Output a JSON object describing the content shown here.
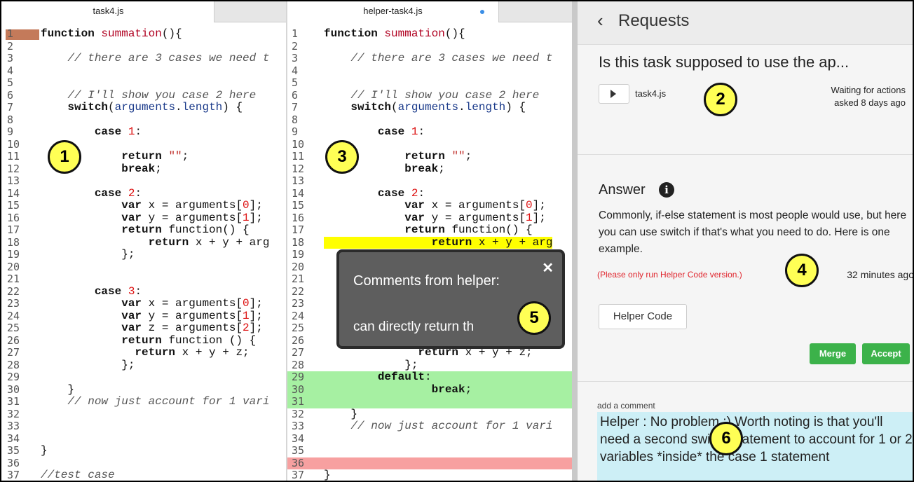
{
  "left_editor": {
    "tab_label": "task4.js",
    "lines": [
      {
        "n": "1",
        "segs": [
          [
            "kw",
            "function "
          ],
          [
            "fn",
            "summation"
          ],
          [
            "",
            "(){"
          ]
        ]
      },
      {
        "n": "2",
        "segs": []
      },
      {
        "n": "3",
        "segs": [
          [
            "",
            "    "
          ],
          [
            "cm",
            "// there are 3 cases we need t"
          ]
        ]
      },
      {
        "n": "4",
        "segs": []
      },
      {
        "n": "5",
        "segs": []
      },
      {
        "n": "6",
        "segs": [
          [
            "",
            "    "
          ],
          [
            "cm",
            "// I'll show you case 2 here"
          ]
        ]
      },
      {
        "n": "7",
        "segs": [
          [
            "",
            "    "
          ],
          [
            "kw",
            "switch"
          ],
          [
            "",
            "("
          ],
          [
            "prop",
            "arguments"
          ],
          [
            "",
            "."
          ],
          [
            "prop",
            "length"
          ],
          [
            "",
            ") {"
          ]
        ]
      },
      {
        "n": "8",
        "segs": []
      },
      {
        "n": "9",
        "segs": [
          [
            "",
            "        "
          ],
          [
            "kw",
            "case "
          ],
          [
            "num",
            "1"
          ],
          [
            "",
            ":"
          ]
        ]
      },
      {
        "n": "10",
        "segs": []
      },
      {
        "n": "11",
        "segs": [
          [
            "",
            "            "
          ],
          [
            "kw",
            "return "
          ],
          [
            "str",
            "\"\""
          ],
          [
            "",
            ";"
          ]
        ]
      },
      {
        "n": "12",
        "segs": [
          [
            "",
            "            "
          ],
          [
            "kw",
            "break"
          ],
          [
            "",
            ";"
          ]
        ]
      },
      {
        "n": "13",
        "segs": []
      },
      {
        "n": "14",
        "segs": [
          [
            "",
            "        "
          ],
          [
            "kw",
            "case "
          ],
          [
            "num",
            "2"
          ],
          [
            "",
            ":"
          ]
        ]
      },
      {
        "n": "15",
        "segs": [
          [
            "",
            "            "
          ],
          [
            "kw",
            "var "
          ],
          [
            "",
            "x = arguments["
          ],
          [
            "num",
            "0"
          ],
          [
            "",
            "];"
          ]
        ]
      },
      {
        "n": "16",
        "segs": [
          [
            "",
            "            "
          ],
          [
            "kw",
            "var "
          ],
          [
            "",
            "y = arguments["
          ],
          [
            "num",
            "1"
          ],
          [
            "",
            "];"
          ]
        ]
      },
      {
        "n": "17",
        "segs": [
          [
            "",
            "            "
          ],
          [
            "kw",
            "return "
          ],
          [
            "",
            "function() {"
          ]
        ]
      },
      {
        "n": "18",
        "segs": [
          [
            "",
            "                "
          ],
          [
            "kw",
            "return "
          ],
          [
            "",
            "x + y + arg"
          ]
        ]
      },
      {
        "n": "19",
        "segs": [
          [
            "",
            "            };"
          ]
        ]
      },
      {
        "n": "20",
        "segs": []
      },
      {
        "n": "21",
        "segs": []
      },
      {
        "n": "22",
        "segs": [
          [
            "",
            "        "
          ],
          [
            "kw",
            "case "
          ],
          [
            "num",
            "3"
          ],
          [
            "",
            ":"
          ]
        ]
      },
      {
        "n": "23",
        "segs": [
          [
            "",
            "            "
          ],
          [
            "kw",
            "var "
          ],
          [
            "",
            "x = arguments["
          ],
          [
            "num",
            "0"
          ],
          [
            "",
            "];"
          ]
        ]
      },
      {
        "n": "24",
        "segs": [
          [
            "",
            "            "
          ],
          [
            "kw",
            "var "
          ],
          [
            "",
            "y = arguments["
          ],
          [
            "num",
            "1"
          ],
          [
            "",
            "];"
          ]
        ]
      },
      {
        "n": "25",
        "segs": [
          [
            "",
            "            "
          ],
          [
            "kw",
            "var "
          ],
          [
            "",
            "z = arguments["
          ],
          [
            "num",
            "2"
          ],
          [
            "",
            "];"
          ]
        ]
      },
      {
        "n": "26",
        "segs": [
          [
            "",
            "            "
          ],
          [
            "kw",
            "return "
          ],
          [
            "",
            "function () {"
          ]
        ]
      },
      {
        "n": "27",
        "segs": [
          [
            "",
            "              "
          ],
          [
            "kw",
            "return "
          ],
          [
            "",
            "x + y + z;"
          ]
        ]
      },
      {
        "n": "28",
        "segs": [
          [
            "",
            "            };"
          ]
        ]
      },
      {
        "n": "29",
        "segs": []
      },
      {
        "n": "30",
        "segs": [
          [
            "",
            "    }"
          ]
        ]
      },
      {
        "n": "31",
        "segs": [
          [
            "",
            "    "
          ],
          [
            "cm",
            "// now just account for 1 vari"
          ]
        ]
      },
      {
        "n": "32",
        "segs": []
      },
      {
        "n": "33",
        "segs": []
      },
      {
        "n": "34",
        "segs": []
      },
      {
        "n": "35",
        "segs": [
          [
            "",
            "}"
          ]
        ]
      },
      {
        "n": "36",
        "segs": []
      },
      {
        "n": "37",
        "segs": [
          [
            "cm",
            "//test case"
          ]
        ]
      }
    ]
  },
  "right_editor": {
    "tab_label": "helper-task4.js",
    "lines": [
      {
        "n": "1",
        "segs": [
          [
            "kw",
            "function "
          ],
          [
            "fn",
            "summation"
          ],
          [
            "",
            "(){"
          ]
        ]
      },
      {
        "n": "2",
        "segs": []
      },
      {
        "n": "3",
        "segs": [
          [
            "",
            "    "
          ],
          [
            "cm",
            "// there are 3 cases we need t"
          ]
        ]
      },
      {
        "n": "4",
        "segs": []
      },
      {
        "n": "5",
        "segs": []
      },
      {
        "n": "6",
        "segs": [
          [
            "",
            "    "
          ],
          [
            "cm",
            "// I'll show you case 2 here"
          ]
        ]
      },
      {
        "n": "7",
        "segs": [
          [
            "",
            "    "
          ],
          [
            "kw",
            "switch"
          ],
          [
            "",
            "("
          ],
          [
            "prop",
            "arguments"
          ],
          [
            "",
            "."
          ],
          [
            "prop",
            "length"
          ],
          [
            "",
            ") {"
          ]
        ]
      },
      {
        "n": "8",
        "segs": []
      },
      {
        "n": "9",
        "segs": [
          [
            "",
            "        "
          ],
          [
            "kw",
            "case "
          ],
          [
            "num",
            "1"
          ],
          [
            "",
            ":"
          ]
        ]
      },
      {
        "n": "10",
        "segs": []
      },
      {
        "n": "11",
        "segs": [
          [
            "",
            "            "
          ],
          [
            "kw",
            "return "
          ],
          [
            "str",
            "\"\""
          ],
          [
            "",
            ";"
          ]
        ]
      },
      {
        "n": "12",
        "segs": [
          [
            "",
            "            "
          ],
          [
            "kw",
            "break"
          ],
          [
            "",
            ";"
          ]
        ]
      },
      {
        "n": "13",
        "segs": []
      },
      {
        "n": "14",
        "segs": [
          [
            "",
            "        "
          ],
          [
            "kw",
            "case "
          ],
          [
            "num",
            "2"
          ],
          [
            "",
            ":"
          ]
        ]
      },
      {
        "n": "15",
        "segs": [
          [
            "",
            "            "
          ],
          [
            "kw",
            "var "
          ],
          [
            "",
            "x = arguments["
          ],
          [
            "num",
            "0"
          ],
          [
            "",
            "];"
          ]
        ]
      },
      {
        "n": "16",
        "segs": [
          [
            "",
            "            "
          ],
          [
            "kw",
            "var "
          ],
          [
            "",
            "y = arguments["
          ],
          [
            "num",
            "1"
          ],
          [
            "",
            "];"
          ]
        ]
      },
      {
        "n": "17",
        "segs": [
          [
            "",
            "            "
          ],
          [
            "kw",
            "return "
          ],
          [
            "",
            "function() {"
          ]
        ]
      },
      {
        "n": "18",
        "hl": "yellow",
        "segs": [
          [
            "",
            "                "
          ],
          [
            "kw",
            "return "
          ],
          [
            "",
            "x + y + arg"
          ]
        ]
      },
      {
        "n": "19",
        "segs": []
      },
      {
        "n": "20",
        "segs": []
      },
      {
        "n": "21",
        "segs": []
      },
      {
        "n": "22",
        "segs": []
      },
      {
        "n": "23",
        "segs": []
      },
      {
        "n": "24",
        "segs": []
      },
      {
        "n": "25",
        "segs": []
      },
      {
        "n": "26",
        "segs": []
      },
      {
        "n": "27",
        "segs": [
          [
            "",
            "              "
          ],
          [
            "kw",
            "return "
          ],
          [
            "",
            "x + y + z;"
          ]
        ]
      },
      {
        "n": "28",
        "segs": [
          [
            "",
            "            };"
          ]
        ]
      },
      {
        "n": "29",
        "hl": "green",
        "segs": [
          [
            "",
            "        "
          ],
          [
            "kw",
            "default"
          ],
          [
            "",
            ":"
          ]
        ]
      },
      {
        "n": "30",
        "hl": "green",
        "segs": [
          [
            "",
            "                "
          ],
          [
            "kw",
            "break"
          ],
          [
            "",
            ";"
          ]
        ]
      },
      {
        "n": "31",
        "hl": "green",
        "segs": []
      },
      {
        "n": "32",
        "segs": [
          [
            "",
            "    }"
          ]
        ]
      },
      {
        "n": "33",
        "segs": [
          [
            "",
            "    "
          ],
          [
            "cm",
            "// now just account for 1 vari"
          ]
        ]
      },
      {
        "n": "34",
        "segs": []
      },
      {
        "n": "35",
        "segs": []
      },
      {
        "n": "36",
        "hl": "red",
        "segs": []
      },
      {
        "n": "37",
        "segs": [
          [
            "",
            "}"
          ]
        ]
      }
    ]
  },
  "popup": {
    "title": "Comments from helper:",
    "text": "can directly return th",
    "close_glyph": "✕"
  },
  "panel": {
    "back_glyph": "‹",
    "title": "Requests",
    "request_title": "Is this task supposed to use the ap...",
    "file_name": "task4.js",
    "status_line1": "Waiting for actions",
    "status_line2": "asked 8 days ago",
    "answer_heading": "Answer",
    "info_glyph": "i",
    "answer_body": "Commonly, if-else statement is most people would use, but here you can use switch if that's what you need to do. Here is one example.",
    "warning": "(Please only run Helper Code version.)",
    "answer_time": "32 minutes ago",
    "helper_code_label": "Helper Code",
    "merge_label": "Merge",
    "accept_label": "Accept",
    "comment_label": "add a comment",
    "comment_text": "Helper : No problem :) Worth noting is that you'll need a second switch statement to account for 1 or 2 variables *inside* the case 1 statement"
  },
  "badges": [
    "1",
    "2",
    "3",
    "4",
    "5",
    "6"
  ],
  "colors": {
    "badge_fill": "#ffff55",
    "added_line": "#a6f0a2",
    "removed_line": "#f7a0a0",
    "highlight_line": "#ffff00",
    "button_green": "#3cb24a",
    "warning_red": "#e0262e",
    "comment_bg": "#cdeff6"
  }
}
